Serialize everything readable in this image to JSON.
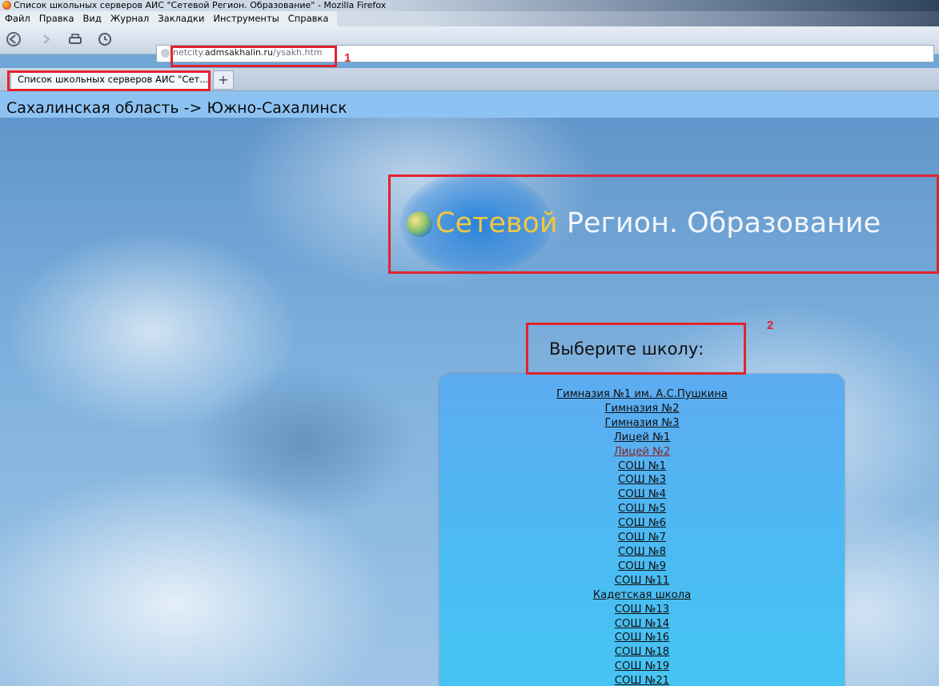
{
  "window": {
    "title": "Список школьных серверов АИС \"Сетевой Регион. Образование\" - Mozilla Firefox"
  },
  "menu": [
    "Файл",
    "Правка",
    "Вид",
    "Журнал",
    "Закладки",
    "Инструменты",
    "Справка"
  ],
  "toolbar": {
    "url_prefix": "netcity.",
    "url_domain": "admsakhalin.ru",
    "url_path": "/ysakh.htm"
  },
  "tab": {
    "label": "Список школьных серверов АИС \"Сет...",
    "new_tab": "+"
  },
  "page": {
    "region": "Сахалинская область -> Южно-Сахалинск",
    "logo_part1": "Сетевой",
    "logo_part2": " Регион. Образование",
    "choose_label": "Выберите школу:",
    "schools": [
      "Гимназия №1 им. А.С.Пушкина",
      "Гимназия №2",
      "Гимназия №3",
      "Лицей №1",
      "Лицей №2",
      "СОШ №1",
      "СОШ №3",
      "СОШ №4",
      "СОШ №5",
      "СОШ №6",
      "СОШ №7",
      "СОШ №8",
      "СОШ №9",
      "СОШ №11",
      "Кадетская школа",
      "СОШ №13",
      "СОШ №14",
      "СОШ №16",
      "СОШ №18",
      "СОШ №19",
      "СОШ №21"
    ],
    "visited_school_index": 4
  },
  "annotations": {
    "label_1": "1",
    "label_2": "2",
    "color": "#e0242e"
  }
}
